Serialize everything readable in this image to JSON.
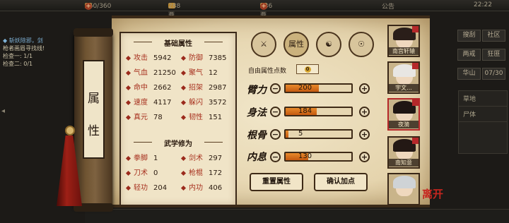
{
  "hud": {
    "stamina": "360/360",
    "money": "288两255文",
    "silver": "536两",
    "announcement": "公告",
    "time": "22:22"
  },
  "quest": {
    "title": "◆ 斩妖除邪，剑",
    "lines": [
      "枪者画眉寻找线!",
      "检查一: 1/1",
      "检查二: 0/1"
    ]
  },
  "right_menu": [
    "搜刮",
    "社区",
    "两戒",
    "狂匪",
    "华山",
    "07/30"
  ],
  "right_panel": [
    "草地",
    "尸体"
  ],
  "scroll_label": "属性",
  "basic": {
    "title": "基础属性",
    "stats": [
      {
        "label": "攻击",
        "value": "5942"
      },
      {
        "label": "防御",
        "value": "7385"
      },
      {
        "label": "气血",
        "value": "21250"
      },
      {
        "label": "聚气",
        "value": "12"
      },
      {
        "label": "命中",
        "value": "2662"
      },
      {
        "label": "招架",
        "value": "2987"
      },
      {
        "label": "速度",
        "value": "4117"
      },
      {
        "label": "躲闪",
        "value": "3572"
      },
      {
        "label": "真元",
        "value": "78"
      },
      {
        "label": "韧性",
        "value": "151"
      }
    ]
  },
  "martial": {
    "title": "武学修为",
    "stats": [
      {
        "label": "拳脚",
        "value": "1"
      },
      {
        "label": "剑术",
        "value": "297"
      },
      {
        "label": "刀术",
        "value": "0"
      },
      {
        "label": "枪棍",
        "value": "172"
      },
      {
        "label": "轻功",
        "value": "204"
      },
      {
        "label": "内功",
        "value": "406"
      }
    ]
  },
  "tabs": [
    {
      "icon": "armor-icon",
      "label": ""
    },
    {
      "icon": "attribute-book-icon",
      "label": "属性"
    },
    {
      "icon": "bagua-icon",
      "label": ""
    },
    {
      "icon": "meridian-body-icon",
      "label": ""
    }
  ],
  "free_points": {
    "label": "自由属性点数",
    "value": "0"
  },
  "attributes": [
    {
      "name": "臂力",
      "value": "200",
      "fraction": 0.5
    },
    {
      "name": "身法",
      "value": "184",
      "fraction": 0.47
    },
    {
      "name": "根骨",
      "value": "5",
      "fraction": 0.04
    },
    {
      "name": "内息",
      "value": "130",
      "fraction": 0.34
    }
  ],
  "buttons": {
    "reset": "重置属性",
    "confirm": "确认加点"
  },
  "characters": [
    {
      "name": "南宫轩辕",
      "hair": "#2a1e19",
      "selected": false
    },
    {
      "name": "宇文...",
      "hair": "#e8e6e3",
      "selected": false
    },
    {
      "name": "夜漪",
      "hair": "#201613",
      "selected": true
    },
    {
      "name": "南知意",
      "hair": "#231814",
      "selected": false
    },
    {
      "name": "",
      "hair": "#cfd3d6",
      "selected": false
    }
  ],
  "close_label": "离开",
  "colors": {
    "accent_red": "#a7311f",
    "bar_fill": "#e88a2b",
    "paper": "#f0e4c7"
  }
}
